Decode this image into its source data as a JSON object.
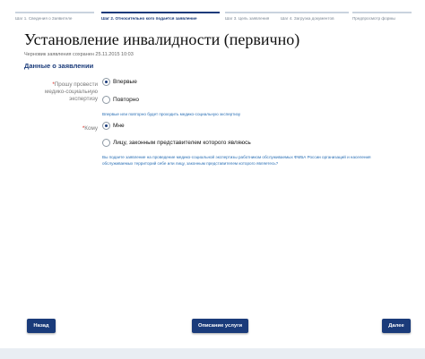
{
  "steps": [
    "Шаг 1. Сведения о Заявителе",
    "Шаг 2. Относительно кого подается заявление",
    "Шаг 3. Цель заявления",
    "Шаг 4. Загрузка документов",
    "Предпросмотр формы"
  ],
  "page": {
    "title": "Установление инвалидности (первично)",
    "draft_note": "Черновик заявления сохранен 25.11.2015 10:03",
    "section_title": "Данные о заявлении"
  },
  "fields": {
    "request": {
      "required_mark": "*",
      "label": "Прошу провести медико-социальную экспертизу",
      "options": [
        "Впервые",
        "Повторно"
      ],
      "selected": "Впервые",
      "hint": "Впервые или повторно будет проходить медико-социальную экспертизу"
    },
    "whom": {
      "required_mark": "*",
      "label": "Кому",
      "options": [
        "Мне",
        "Лицу, законным представителем которого являюсь"
      ],
      "selected": "Мне",
      "hint": "Вы подаете заявление на проведение медико-социальной экспертизы работником обслуживаемых ФМБА России организаций и населения обслуживаемых территорий себе или лицу, законным представителем которого являетесь?"
    }
  },
  "buttons": {
    "back": "Назад",
    "service_description": "Описание услуги",
    "next": "Далее"
  }
}
